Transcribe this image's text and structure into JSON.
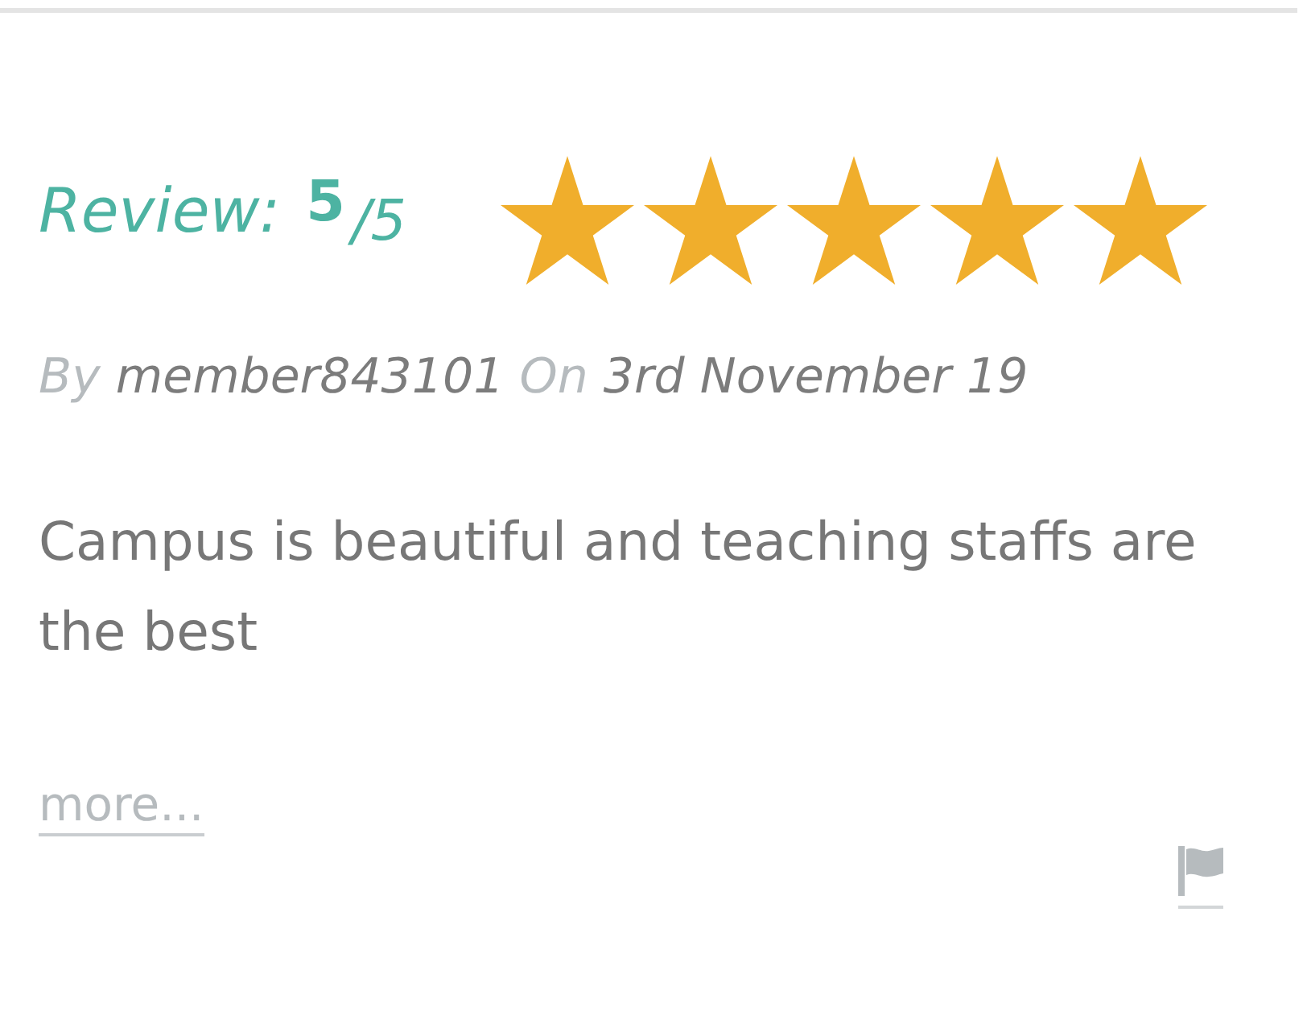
{
  "review": {
    "label": "Review:",
    "score": "5",
    "out_of": "/5",
    "stars": 5
  },
  "byline": {
    "by": "By",
    "author": "member843101",
    "on": "On",
    "date": "3rd November 19"
  },
  "comment": "Campus is beautiful and teaching staffs are the best",
  "more_link": "more..."
}
